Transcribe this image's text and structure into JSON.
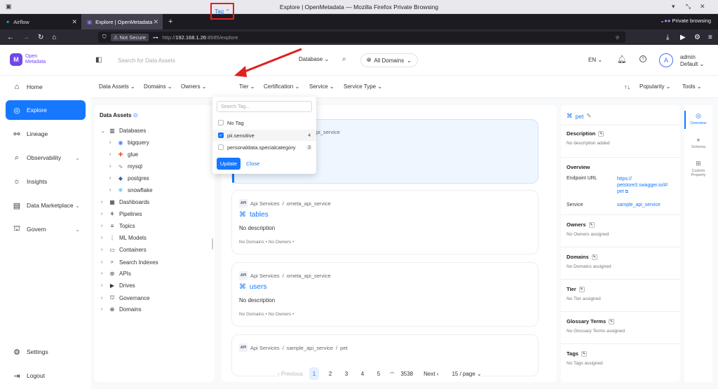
{
  "window": {
    "title": "Explore | OpenMetadata — Mozilla Firefox Private Browsing"
  },
  "tabs": [
    {
      "label": "Airflow"
    },
    {
      "label": "Explore | OpenMetadata"
    }
  ],
  "browser": {
    "not_secure": "Not Secure",
    "url_prefix": "http://",
    "url_host": "192.168.1.26",
    "url_rest": ":8585/explore",
    "private_label": "Private browsing"
  },
  "header": {
    "logo_line1": "Open",
    "logo_line2": "Metadata",
    "search_placeholder": "Search for Data Assets",
    "search_scope": "Database",
    "domains": "All Domains",
    "lang": "EN",
    "avatar_letter": "A",
    "user_name": "admin",
    "user_role": "Default"
  },
  "nav": {
    "items": [
      {
        "label": "Home",
        "icon": "home-icon"
      },
      {
        "label": "Explore",
        "icon": "compass-icon"
      },
      {
        "label": "Lineage",
        "icon": "lineage-icon"
      },
      {
        "label": "Observability",
        "icon": "observability-icon"
      },
      {
        "label": "Insights",
        "icon": "insights-icon"
      },
      {
        "label": "Data Marketplace",
        "icon": "marketplace-icon"
      },
      {
        "label": "Govern",
        "icon": "govern-icon"
      }
    ],
    "settings": "Settings",
    "logout": "Logout"
  },
  "filters": {
    "data_assets": "Data Assets",
    "domains": "Domains",
    "owners": "Owners",
    "tag": "Tag",
    "tier": "Tier",
    "certification": "Certification",
    "service": "Service",
    "service_type": "Service Type",
    "sort": "Popularity",
    "tools": "Tools"
  },
  "data_assets_panel": {
    "title": "Data Assets",
    "databases": "Databases",
    "db_children": [
      "bigquery",
      "glue",
      "mysql",
      "postgres",
      "snowflake"
    ],
    "others": [
      "Dashboards",
      "Pipelines",
      "Topics",
      "ML Models",
      "Containers",
      "Search Indexes",
      "APIs",
      "Drives",
      "Governance",
      "Domains"
    ]
  },
  "tag_dropdown": {
    "search_placeholder": "Search Tag...",
    "options": [
      {
        "label": "No Tag",
        "checked": false,
        "count": ""
      },
      {
        "label": "pii.sensitive",
        "checked": true,
        "count": "4"
      },
      {
        "label": "personaldata.specialcategory",
        "checked": false,
        "count": "2"
      }
    ],
    "update": "Update",
    "close": "Close"
  },
  "results": {
    "first_card_service_fragment": "pi_service",
    "cards": [
      {
        "service": "Api Services",
        "sep": "/",
        "sub": "ometa_api_service",
        "name": "tables",
        "desc": "No description",
        "meta": "No Domains • No Owners •"
      },
      {
        "service": "Api Services",
        "sep": "/",
        "sub": "ometa_api_service",
        "name": "users",
        "desc": "No description",
        "meta": "No Domains • No Owners •"
      },
      {
        "service": "Api Services",
        "sep": "/",
        "sub": "sample_api_service",
        "sub2": "pet"
      }
    ],
    "svc_icon_text": "API",
    "pager": {
      "prev": "Previous",
      "pages": [
        "1",
        "2",
        "3",
        "4",
        "5"
      ],
      "ellipsis": "•••",
      "last": "3538",
      "next": "Next",
      "per_page": "15 / page"
    }
  },
  "detail": {
    "title": "pet",
    "description_label": "Description",
    "description_value": "No description added",
    "overview_label": "Overview",
    "endpoint_label": "Endpoint URL",
    "endpoint_value": "https:// petstore3.swagger.io/#/ pet",
    "service_label": "Service",
    "service_value": "sample_api_service",
    "owners_label": "Owners",
    "owners_value": "No Owners assigned",
    "domains_label": "Domains",
    "domains_value": "No Domains assigned",
    "tier_label": "Tier",
    "tier_value": "No Tier assigned",
    "glossary_label": "Glossary Terms",
    "glossary_value": "No Glossary Terms assigned",
    "tags_label": "Tags",
    "tags_value": "No Tags assigned"
  },
  "right_tabs": {
    "overview": "Overview",
    "schema": "Schema",
    "custom": "Custom Property"
  },
  "colors": {
    "primary": "#1677ff",
    "brand": "#7147e8",
    "annotation_red": "#e02020"
  }
}
